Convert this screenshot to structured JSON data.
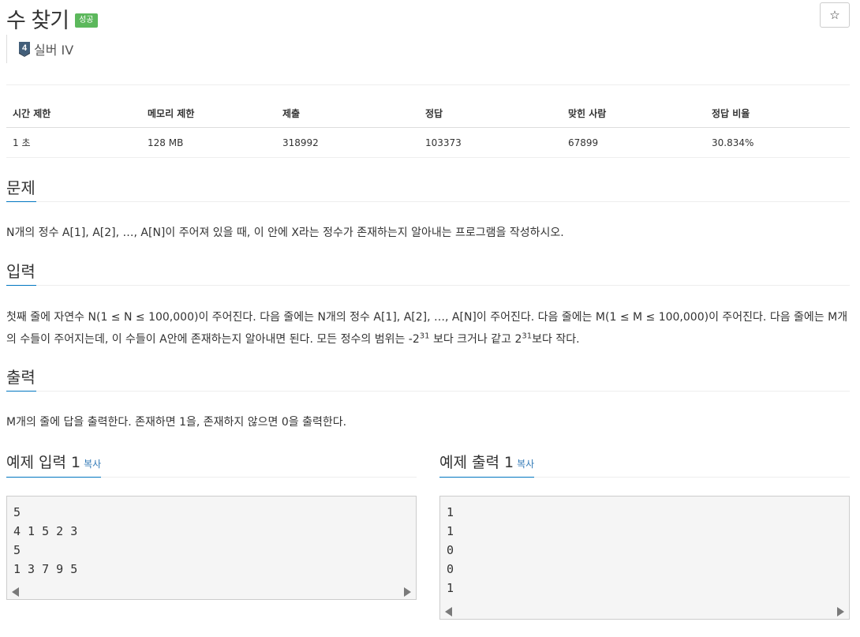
{
  "problem": {
    "title": "수 찾기",
    "status_badge": "성공",
    "favorite_icon": "☆",
    "tier_number": "4",
    "tier_label": "실버 IV"
  },
  "stats": {
    "headers": [
      "시간 제한",
      "메모리 제한",
      "제출",
      "정답",
      "맞힌 사람",
      "정답 비율"
    ],
    "values": [
      "1 초",
      "128 MB",
      "318992",
      "103373",
      "67899",
      "30.834%"
    ]
  },
  "sections": {
    "description": {
      "title": "문제",
      "text": "N개의 정수 A[1], A[2], …, A[N]이 주어져 있을 때, 이 안에 X라는 정수가 존재하는지 알아내는 프로그램을 작성하시오."
    },
    "input": {
      "title": "입력",
      "line1": "첫째 줄에 자연수 N(1 ≤ N ≤ 100,000)이 주어진다. 다음 줄에는 N개의 정수 A[1], A[2], …, A[N]이 주어진다. 다음 줄에는 M(1 ≤ M ≤ 100,000)이 주어진다. 다음 줄에는 M개",
      "line2_prefix": "의 수들이 주어지는데, 이 수들이 A안에 존재하는지 알아내면 된다. 모든 정수의 범위는 -2",
      "exp1": "31",
      "line2_middle": " 보다 크거나 같고 2",
      "exp2": "31",
      "line2_suffix": "보다 작다."
    },
    "output": {
      "title": "출력",
      "text": "M개의 줄에 답을 출력한다. 존재하면 1을, 존재하지 않으면 0을 출력한다."
    }
  },
  "samples": {
    "input": {
      "title": "예제 입력 1",
      "copy_label": "복사",
      "lines": [
        "5",
        "4 1 5 2 3",
        "5",
        "1 3 7 9 5"
      ]
    },
    "output": {
      "title": "예제 출력 1",
      "copy_label": "복사",
      "lines": [
        "1",
        "1",
        "0",
        "0",
        "1"
      ]
    }
  },
  "colors": {
    "success": "#5cb85c",
    "link": "#337ab7",
    "section_underline": "#0076c0",
    "tier_silver": "#435f7a"
  },
  "icons": {
    "favorite": "star-icon",
    "tier": "silver-tier-icon",
    "scroll_left": "arrow-left-icon",
    "scroll_right": "arrow-right-icon"
  }
}
